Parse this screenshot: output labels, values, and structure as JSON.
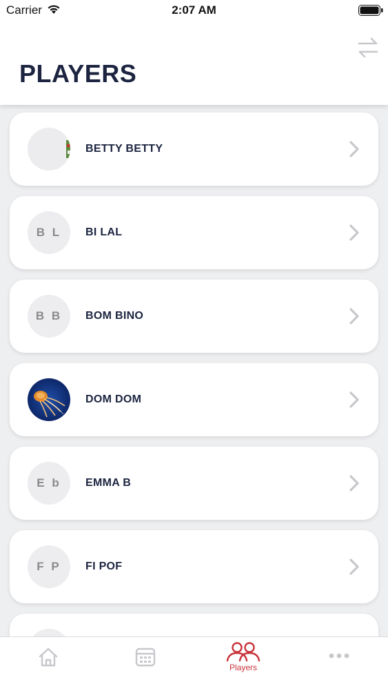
{
  "status_bar": {
    "carrier": "Carrier",
    "time": "2:07 AM"
  },
  "header": {
    "title": "PLAYERS",
    "swap_icon": "swap-arrows-icon"
  },
  "players": [
    {
      "name": "BETTY BETTY",
      "initials": "",
      "avatar": "photo-plant"
    },
    {
      "name": "BI LAL",
      "initials": "B L",
      "avatar": "initials"
    },
    {
      "name": "BOM BINO",
      "initials": "B B",
      "avatar": "initials"
    },
    {
      "name": "DOM DOM",
      "initials": "",
      "avatar": "photo-jellyfish"
    },
    {
      "name": "EMMA B",
      "initials": "E b",
      "avatar": "initials"
    },
    {
      "name": "FI POF",
      "initials": "F P",
      "avatar": "initials"
    },
    {
      "name": "",
      "initials": "",
      "avatar": "initials"
    }
  ],
  "tab_bar": {
    "tabs": [
      {
        "icon": "home-icon",
        "label": ""
      },
      {
        "icon": "calendar-icon",
        "label": ""
      },
      {
        "icon": "players-icon",
        "label": "Players",
        "active": true
      },
      {
        "icon": "more-icon",
        "label": ""
      }
    ]
  },
  "colors": {
    "title": "#1c2440",
    "accent": "#c8323a",
    "inactive_icon": "#c7c7cc"
  }
}
